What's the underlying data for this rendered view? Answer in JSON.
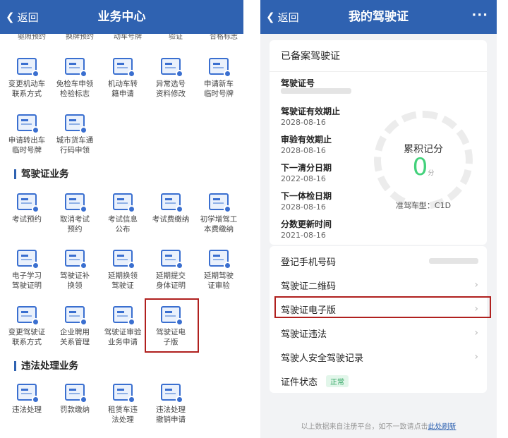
{
  "left": {
    "back_label": "返回",
    "title": "业务中心",
    "cut_row": [
      "驱照预约",
      "换牌预约",
      "动车号牌",
      "验证",
      "合格标志"
    ],
    "grid1": [
      {
        "label": "变更机动车\n联系方式",
        "icon": "phone-card-icon"
      },
      {
        "label": "免检车申领\n检验标志",
        "icon": "badge-icon"
      },
      {
        "label": "机动车转\n籍申请",
        "icon": "document-icon"
      },
      {
        "label": "异常选号\n资料修改",
        "icon": "edit-icon"
      },
      {
        "label": "申请新车\n临时号牌",
        "icon": "plate-icon"
      },
      {
        "label": "申请转出车\n临时号牌",
        "icon": "plate-out-icon"
      },
      {
        "label": "城市货车通\n行码申领",
        "icon": "truck-icon"
      }
    ],
    "section_license": "驾驶证业务",
    "grid2": [
      {
        "label": "考试预约",
        "icon": "calendar-icon"
      },
      {
        "label": "取消考试\n预约",
        "icon": "calendar-cancel-icon"
      },
      {
        "label": "考试信息\n公布",
        "icon": "info-icon"
      },
      {
        "label": "考试费缴纳",
        "icon": "payment-icon"
      },
      {
        "label": "初学增驾工\n本费缴纳",
        "icon": "id-card-icon"
      },
      {
        "label": "电子学习\n驾驶证明",
        "icon": "certificate-icon"
      },
      {
        "label": "驾驶证补\n换领",
        "icon": "license-icon"
      },
      {
        "label": "延期换领\n驾驶证",
        "icon": "license-renew-icon"
      },
      {
        "label": "延期提交\n身体证明",
        "icon": "health-icon"
      },
      {
        "label": "延期驾驶\n证审验",
        "icon": "license-check-icon"
      },
      {
        "label": "变更驾驶证\n联系方式",
        "icon": "phone-card-icon"
      },
      {
        "label": "企业聘用\n关系管理",
        "icon": "enterprise-icon"
      },
      {
        "label": "驾驶证审验\n业务申请",
        "icon": "review-icon"
      },
      {
        "label": "驾驶证电\n子版",
        "icon": "e-license-icon"
      }
    ],
    "section_violation": "违法处理业务",
    "grid3": [
      {
        "label": "违法处理",
        "icon": "car-icon"
      },
      {
        "label": "罚款缴纳",
        "icon": "fine-icon"
      },
      {
        "label": "租赁车违\n法处理",
        "icon": "rental-car-icon"
      },
      {
        "label": "违法处理\n撤销申请",
        "icon": "car-revoke-icon"
      }
    ]
  },
  "right": {
    "back_label": "返回",
    "title": "我的驾驶证",
    "more": "···",
    "card_title": "已备案驾驶证",
    "fields": [
      {
        "label": "驾驶证号",
        "value": ""
      },
      {
        "label": "驾驶证有效期止",
        "value": "2028-08-16"
      },
      {
        "label": "审验有效期止",
        "value": "2028-08-16"
      },
      {
        "label": "下一清分日期",
        "value": "2022-08-16"
      },
      {
        "label": "下一体检日期",
        "value": "2028-08-16"
      },
      {
        "label": "分数更新时间",
        "value": "2021-08-16"
      }
    ],
    "gauge_label": "累积记分",
    "score": "0",
    "score_unit": "分",
    "vehicle_type": "准驾车型：C1D",
    "rows": [
      "登记手机号码",
      "驾驶证二维码",
      "驾驶证电子版",
      "驾驶证违法",
      "驾驶人安全驾驶记录",
      "证件状态"
    ],
    "status": "正常",
    "footer_text": "以上数据来自注册平台，如不一致请点击",
    "footer_link": "此处刷新"
  },
  "colors": {
    "brand": "#2f62b1",
    "highlight": "#b0201e",
    "score": "#43d17b"
  }
}
